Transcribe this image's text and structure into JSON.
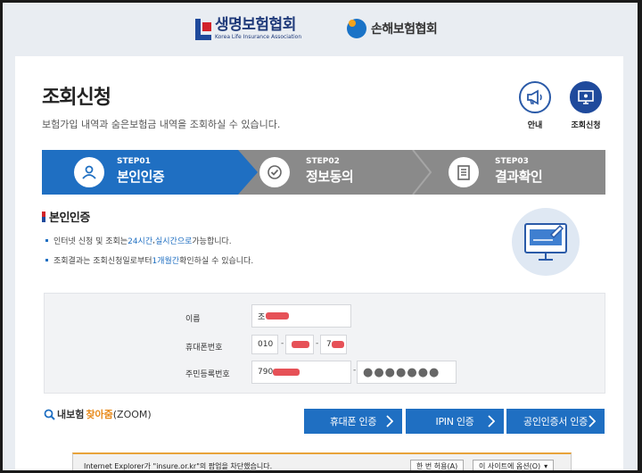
{
  "header": {
    "logo_left_ko": "생명보험협회",
    "logo_left_en": "Korea Life Insurance Association",
    "logo_right_ko": "손해보험협회"
  },
  "page": {
    "title": "조회신청",
    "description": "보험가입 내역과 숨은보험금 내역을 조회하실 수 있습니다."
  },
  "quick_links": [
    {
      "label": "안내",
      "icon": "megaphone-icon"
    },
    {
      "label": "조회신청",
      "icon": "monitor-icon"
    }
  ],
  "steps": [
    {
      "no": "STEP01",
      "name": "본인인증",
      "icon": "user-icon",
      "active": true
    },
    {
      "no": "STEP02",
      "name": "정보동의",
      "icon": "check-circle-icon",
      "active": false
    },
    {
      "no": "STEP03",
      "name": "결과확인",
      "icon": "document-icon",
      "active": false
    }
  ],
  "section": {
    "title": "본인인증",
    "info1_pre": "인터넷 신청 및 조회는 ",
    "info1_hl1": "24시간",
    "info1_mid": ", ",
    "info1_hl2": "실시간으로",
    "info1_post": " 가능합니다.",
    "info2_pre": "조회결과는 조회신청일로부터 ",
    "info2_hl": "1개월간",
    "info2_post": " 확인하실 수 있습니다."
  },
  "form": {
    "name_label": "이름",
    "name_value": "조",
    "phone_label": "휴대폰번호",
    "phone_prefix": "010",
    "phone_mid_visible": "",
    "phone_last_visible": "7",
    "rrn_label": "주민등록번호",
    "rrn_front_visible": "790",
    "rrn_back_masked": "●●●●●●●",
    "dash": "-"
  },
  "bottom": {
    "zoom_pre": "내보험",
    "zoom_hl": "찾아줌",
    "zoom_post": "(ZOOM)",
    "btn_phone": "휴대폰 인증",
    "btn_ipin": "IPIN 인증",
    "btn_cert": "공인인증서 인증"
  },
  "ie_bar": {
    "message": "Internet Explorer가 \"insure.or.kr\"의 팝업을 차단했습니다.",
    "btn_once": "한 번 허용(A)",
    "btn_options": "이 사이트에 옵션(O)"
  },
  "colors": {
    "primary": "#1f6fc2",
    "step_inactive": "#8a8a8a",
    "accent_orange": "#e88a1a",
    "brand_red": "#d2232a"
  }
}
